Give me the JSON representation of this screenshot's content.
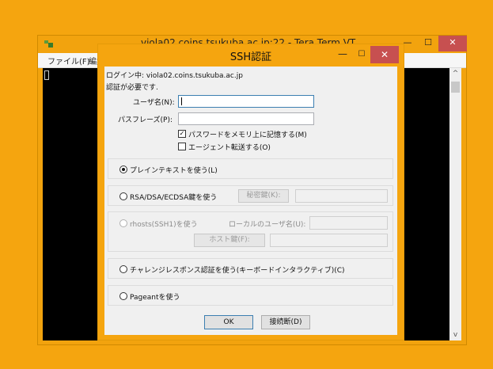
{
  "terminal": {
    "title": "viola02.coins.tsukuba.ac.jp:22 - Tera Term VT",
    "menu": [
      "ファイル(F)",
      "編集"
    ],
    "icons": {
      "app": "teraterm-icon",
      "minimize": "minimize-icon",
      "maximize": "maximize-icon",
      "close": "close-icon"
    },
    "scroll_up": "^",
    "scroll_down": "v"
  },
  "dialog": {
    "title": "SSH認証",
    "login_text": "ログイン中: viola02.coins.tsukuba.ac.jp",
    "auth_required": "認証が必要です.",
    "username_label": "ユーザ名(N):",
    "username_value": "",
    "passphrase_label": "パスフレーズ(P):",
    "passphrase_value": "",
    "remember_password": {
      "label": "パスワードをメモリ上に記憶する(M)",
      "checked": true
    },
    "agent_forward": {
      "label": "エージェント転送する(O)",
      "checked": false
    },
    "methods": {
      "plaintext": {
        "label": "プレインテキストを使う(L)",
        "selected": true
      },
      "rsa": {
        "label": "RSA/DSA/ECDSA鍵を使う",
        "selected": false,
        "key_button": "秘密鍵(K):",
        "key_value": ""
      },
      "rhosts": {
        "label": "rhosts(SSH1)を使う",
        "selected": false,
        "enabled": false,
        "local_user_label": "ローカルのユーザ名(U):",
        "host_key_button": "ホスト鍵(F):"
      },
      "challenge": {
        "label": "チャレンジレスポンス認証を使う(キーボードインタラクティブ)(C)",
        "selected": false
      },
      "pageant": {
        "label": "Pageantを使う",
        "selected": false
      }
    },
    "ok_label": "OK",
    "disconnect_label": "接続断(D)",
    "check_mark": "✓"
  }
}
